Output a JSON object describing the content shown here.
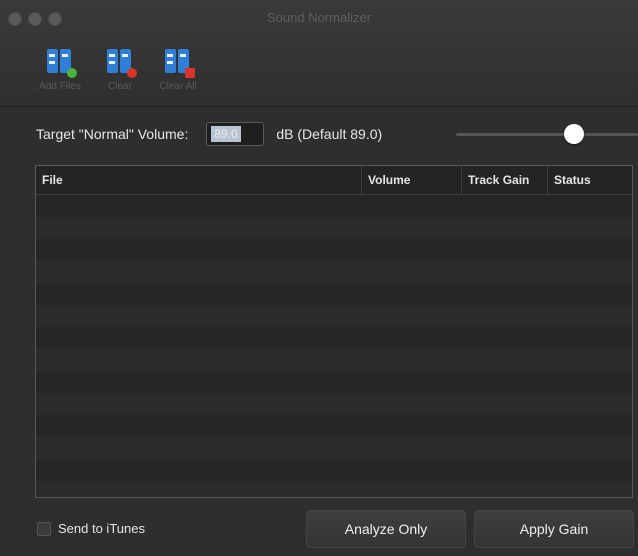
{
  "window": {
    "title": "Sound Normalizer"
  },
  "toolbar": {
    "items": [
      {
        "label": "Add Files",
        "icon": "add-files-icon"
      },
      {
        "label": "Clear",
        "icon": "clear-icon"
      },
      {
        "label": "Clear All",
        "icon": "clear-all-icon"
      }
    ]
  },
  "settings": {
    "target_label": "Target \"Normal\" Volume:",
    "volume_value": "89.0",
    "default_label": "dB (Default 89.0)"
  },
  "table": {
    "columns": [
      "File",
      "Volume",
      "Track Gain",
      "Status"
    ]
  },
  "bottom": {
    "send_label": "Send to iTunes",
    "analyze_label": "Analyze Only",
    "apply_label": "Apply Gain"
  },
  "colors": {
    "accent": "#2f7fd8",
    "add_badge": "#4bb43a",
    "clear_badge": "#d8342c"
  }
}
